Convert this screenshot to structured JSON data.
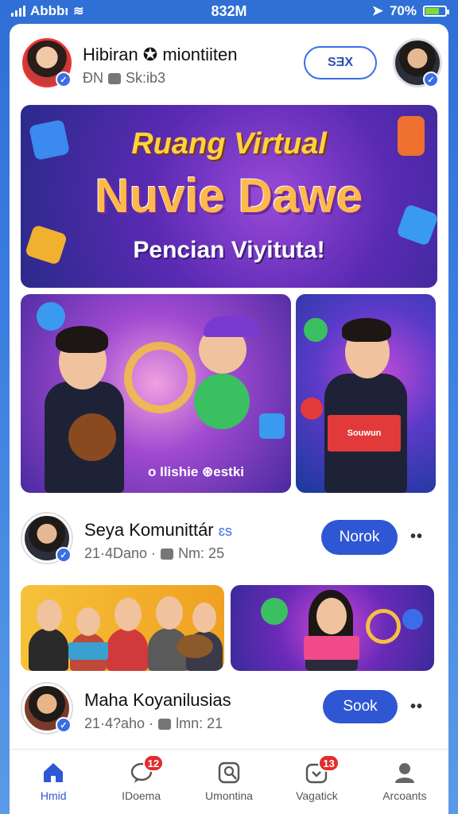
{
  "status_bar": {
    "carrier": "Abbbı",
    "time": "832M",
    "battery": "70%",
    "battery_level": 0.7
  },
  "post1": {
    "name": "Hibiran ✪ miontiiten",
    "meta_prefix": "ÐN",
    "meta_comments": "Sk:ib3",
    "action_label": "SƎX"
  },
  "banner": {
    "line1": "Ruang Virtual",
    "line2": "Nuvie Dawe",
    "line3": "Pencian Viyituta!"
  },
  "media1": {
    "caption": "o Ilishie ⊛estki"
  },
  "media2": {
    "box_label": "Souwun"
  },
  "post2": {
    "name": "Seya Komunittár",
    "verified_tag": "ɛs",
    "meta": "21·4Dano · ",
    "meta_count": "Nm: 25",
    "button": "Norok",
    "more": "••"
  },
  "post3": {
    "name": "Maha Koyanilusias",
    "meta": "21·4?aho · ",
    "meta_count": "lmn: 21",
    "button": "Sook",
    "more": "••"
  },
  "nav": [
    {
      "label": "Hmid",
      "icon": "home-icon",
      "active": true
    },
    {
      "label": "IDoema",
      "icon": "chat-bubble-icon",
      "badge": "12"
    },
    {
      "label": "Umontina",
      "icon": "profile-card-icon"
    },
    {
      "label": "Vagatick",
      "icon": "notification-icon",
      "badge": "13"
    },
    {
      "label": "Arcoants",
      "icon": "account-icon"
    }
  ],
  "colors": {
    "accent": "#2f57d4",
    "badge": "#e22c2c",
    "header_bg": "#2f6fd6"
  }
}
